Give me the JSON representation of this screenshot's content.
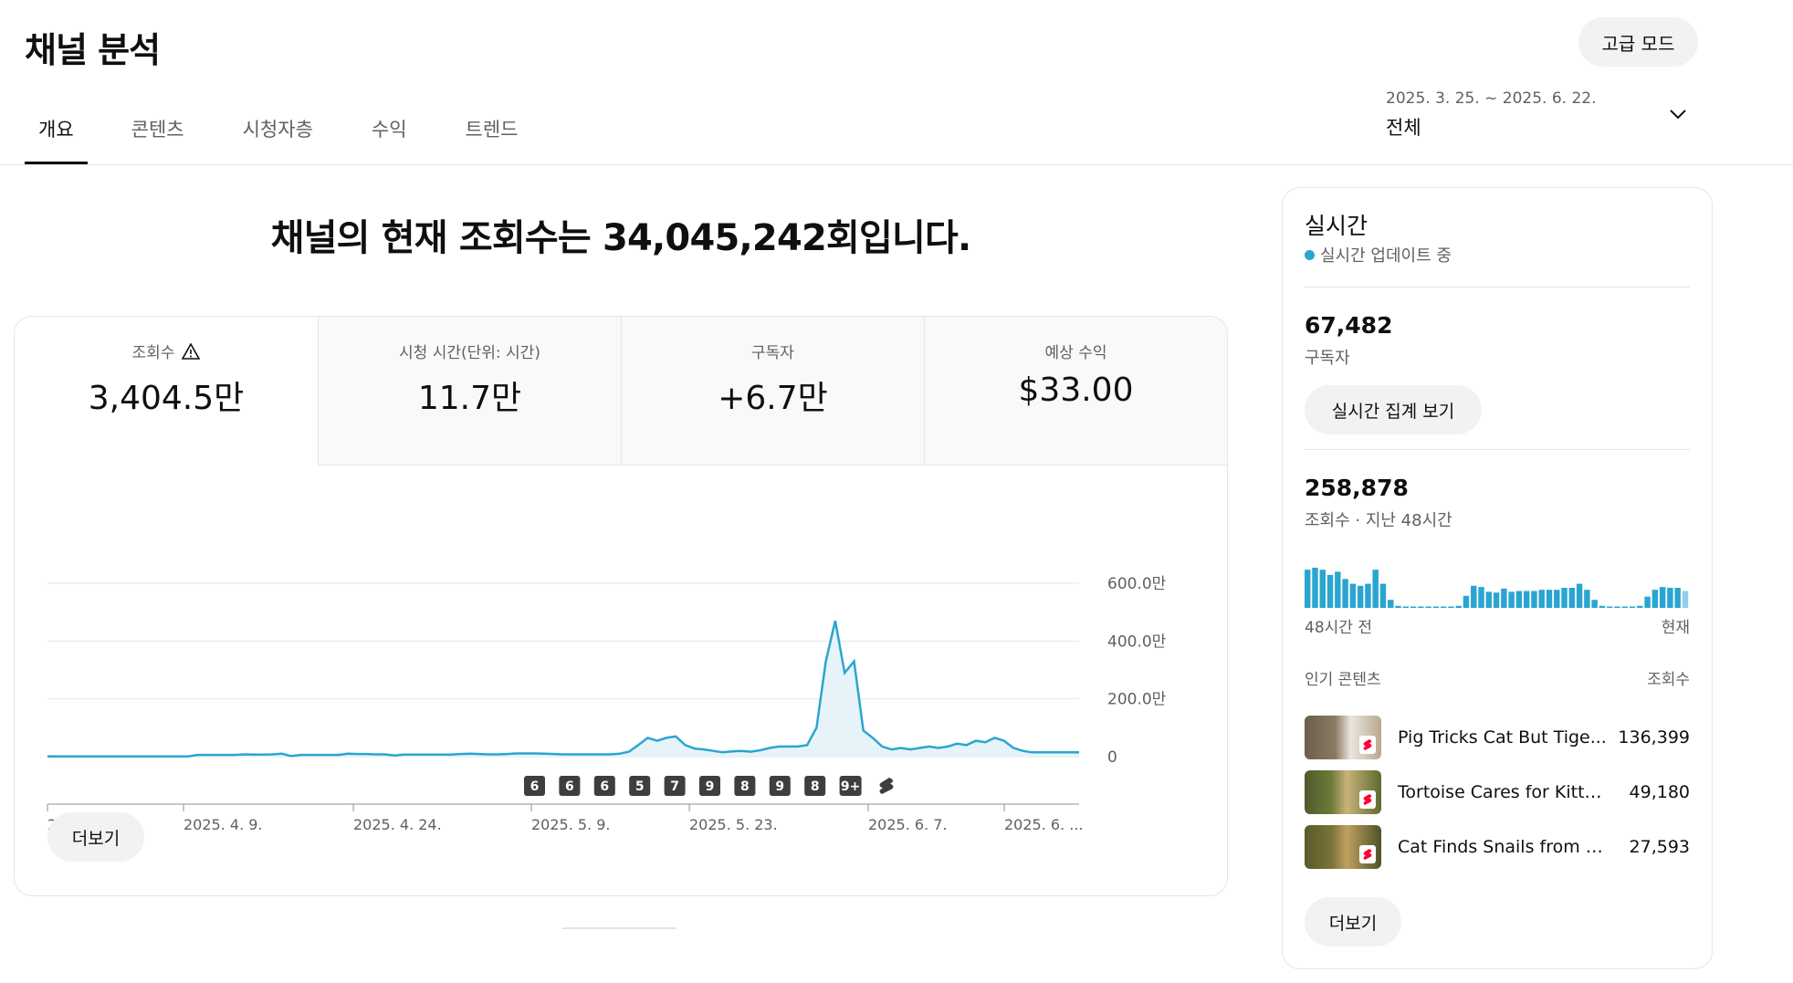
{
  "header": {
    "title": "채널 분석",
    "advanced_mode_label": "고급 모드",
    "tabs": [
      {
        "label": "개요",
        "active": true
      },
      {
        "label": "콘텐츠",
        "active": false
      },
      {
        "label": "시청자층",
        "active": false
      },
      {
        "label": "수익",
        "active": false
      },
      {
        "label": "트렌드",
        "active": false
      }
    ],
    "date_range": {
      "range": "2025. 3. 25. ~ 2025. 6. 22.",
      "period": "전체"
    }
  },
  "headline": "채널의 현재 조회수는 34,045,242회입니다.",
  "metrics": [
    {
      "label": "조회수",
      "value": "3,404.5만",
      "warning": true
    },
    {
      "label": "시청 시간(단위: 시간)",
      "value": "11.7만"
    },
    {
      "label": "구독자",
      "value": "+6.7만"
    },
    {
      "label": "예상 수익",
      "value": "$33.00"
    }
  ],
  "chart_data": {
    "type": "area",
    "title": "",
    "xlabel": "",
    "ylabel": "",
    "x_tick_labels": [
      "2025. 3. ...",
      "2025. 4. 9.",
      "2025. 4. 24.",
      "2025. 5. 9.",
      "2025. 5. 23.",
      "2025. 6. 7.",
      "2025. 6. ..."
    ],
    "y_tick_labels": [
      "600.0만",
      "400.0만",
      "200.0만",
      "0"
    ],
    "ylim": [
      0,
      6000000
    ],
    "grid": true,
    "series": [
      {
        "values": [
          10000,
          10000,
          10000,
          10000,
          10000,
          10000,
          10000,
          10000,
          10000,
          10000,
          10000,
          10000,
          10000,
          10000,
          10000,
          10000,
          60000,
          60000,
          60000,
          60000,
          60000,
          80000,
          70000,
          70000,
          80000,
          100000,
          20000,
          60000,
          60000,
          60000,
          60000,
          60000,
          100000,
          90000,
          90000,
          80000,
          80000,
          40000,
          70000,
          70000,
          70000,
          70000,
          70000,
          70000,
          90000,
          100000,
          90000,
          80000,
          80000,
          90000,
          110000,
          110000,
          110000,
          100000,
          90000,
          80000,
          80000,
          80000,
          80000,
          80000,
          80000,
          100000,
          170000,
          400000,
          650000,
          550000,
          650000,
          700000,
          400000,
          280000,
          250000,
          200000,
          150000,
          180000,
          200000,
          170000,
          220000,
          300000,
          350000,
          350000,
          350000,
          400000,
          1000000,
          3300000,
          4700000,
          2900000,
          3300000,
          900000,
          650000,
          350000,
          250000,
          300000,
          250000,
          300000,
          350000,
          300000,
          350000,
          450000,
          400000,
          550000,
          500000,
          650000,
          550000,
          300000,
          200000,
          150000,
          150000,
          150000,
          150000,
          150000,
          150000
        ]
      }
    ],
    "video_markers": [
      "6",
      "6",
      "6",
      "5",
      "7",
      "9",
      "8",
      "9",
      "8",
      "9+"
    ]
  },
  "more_label": "더보기",
  "realtime": {
    "title": "실시간",
    "live_text": "실시간 업데이트 중",
    "subscribers_value": "67,482",
    "subscribers_label": "구독자",
    "button_label": "실시간 집계 보기",
    "views_value": "258,878",
    "views_label": "조회수 · 지난 48시간",
    "bars": [
      0.95,
      1.0,
      0.95,
      0.82,
      0.9,
      0.72,
      0.6,
      0.55,
      0.6,
      0.95,
      0.6,
      0.2,
      0.05,
      0.02,
      0.02,
      0.02,
      0.02,
      0.02,
      0.02,
      0.02,
      0.05,
      0.3,
      0.55,
      0.52,
      0.4,
      0.38,
      0.48,
      0.4,
      0.42,
      0.42,
      0.42,
      0.45,
      0.45,
      0.45,
      0.5,
      0.5,
      0.6,
      0.45,
      0.2,
      0.05,
      0.02,
      0.02,
      0.02,
      0.02,
      0.05,
      0.28,
      0.45,
      0.52,
      0.5,
      0.5,
      0.42
    ],
    "bar_start_label": "48시간 전",
    "bar_end_label": "현재",
    "bar_color": "#2ba5d0",
    "popular_header": "인기 콘텐츠",
    "popular_views_header": "조회수",
    "popular": [
      {
        "title": "Pig Tricks Cat But Tige...",
        "views": "136,399"
      },
      {
        "title": "Tortoise Cares for Kitten...",
        "views": "49,180"
      },
      {
        "title": "Cat Finds Snails from a ...",
        "views": "27,593"
      }
    ],
    "more_label": "더보기"
  }
}
